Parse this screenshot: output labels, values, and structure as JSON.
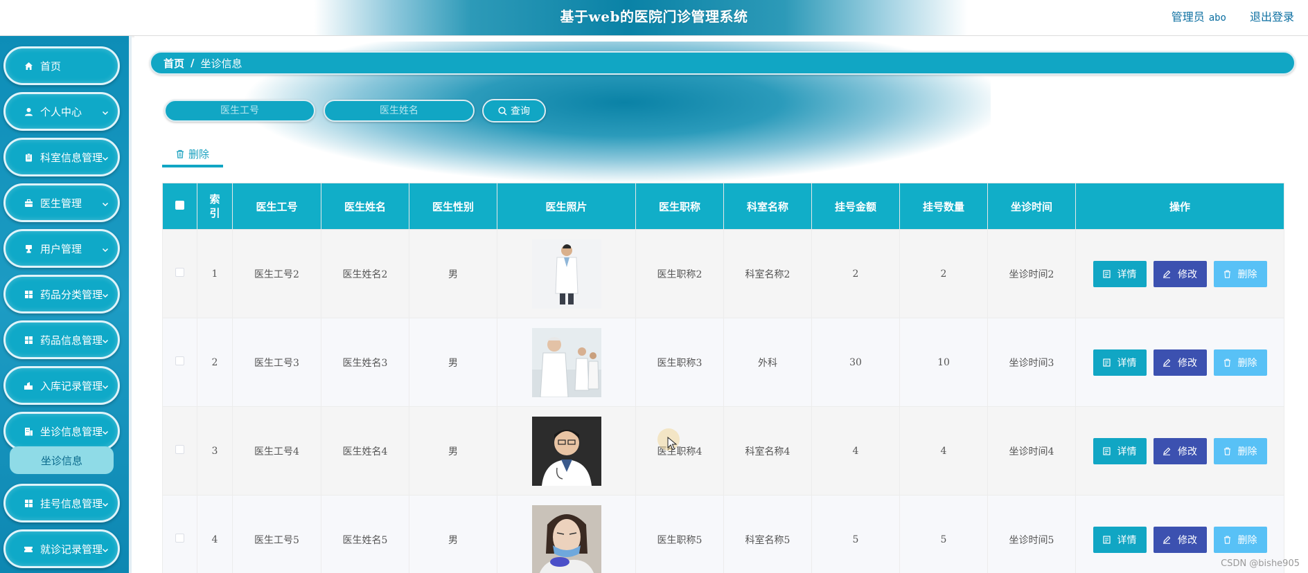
{
  "header": {
    "title": "基于web的医院门诊管理系统",
    "user_role": "管理员",
    "username": "abo",
    "logout": "退出登录"
  },
  "sidebar": {
    "items": [
      {
        "label": "首页",
        "icon": "home-icon",
        "has_children": false
      },
      {
        "label": "个人中心",
        "icon": "user-icon",
        "has_children": true
      },
      {
        "label": "科室信息管理",
        "icon": "clipboard-icon",
        "has_children": true
      },
      {
        "label": "医生管理",
        "icon": "briefcase-icon",
        "has_children": true
      },
      {
        "label": "用户管理",
        "icon": "stamp-icon",
        "has_children": true
      },
      {
        "label": "药品分类管理",
        "icon": "grid-icon",
        "has_children": true
      },
      {
        "label": "药品信息管理",
        "icon": "grid-icon",
        "has_children": true
      },
      {
        "label": "入库记录管理",
        "icon": "inbox-icon",
        "has_children": true
      },
      {
        "label": "坐诊信息管理",
        "icon": "building-icon",
        "has_children": true
      },
      {
        "label": "挂号信息管理",
        "icon": "grid-icon",
        "has_children": true
      },
      {
        "label": "就诊记录管理",
        "icon": "ticket-icon",
        "has_children": true
      }
    ],
    "active_submenu": "坐诊信息"
  },
  "breadcrumb": {
    "home": "首页",
    "separator": "/",
    "current": "坐诊信息"
  },
  "search": {
    "doctor_id_placeholder": "医生工号",
    "doctor_name_placeholder": "医生姓名",
    "query_label": "查询"
  },
  "toolbar": {
    "delete_label": "删除"
  },
  "table": {
    "columns": [
      "索引",
      "医生工号",
      "医生姓名",
      "医生性别",
      "医生照片",
      "医生职称",
      "科室名称",
      "挂号金额",
      "挂号数量",
      "坐诊时间",
      "操作"
    ],
    "rows": [
      {
        "index": "1",
        "doctor_id": "医生工号2",
        "doctor_name": "医生姓名2",
        "gender": "男",
        "photo": "doctor-photo-white-coat",
        "title": "医生职称2",
        "department": "科室名称2",
        "fee": "2",
        "count": "2",
        "time": "坐诊时间2"
      },
      {
        "index": "2",
        "doctor_id": "医生工号3",
        "doctor_name": "医生姓名3",
        "gender": "男",
        "photo": "doctor-photo-group",
        "title": "医生职称3",
        "department": "外科",
        "fee": "30",
        "count": "10",
        "time": "坐诊时间3"
      },
      {
        "index": "3",
        "doctor_id": "医生工号4",
        "doctor_name": "医生姓名4",
        "gender": "男",
        "photo": "doctor-photo-portrait",
        "title": "医生职称4",
        "department": "科室名称4",
        "fee": "4",
        "count": "4",
        "time": "坐诊时间4"
      },
      {
        "index": "4",
        "doctor_id": "医生工号5",
        "doctor_name": "医生姓名5",
        "gender": "男",
        "photo": "doctor-photo-mask",
        "title": "医生职称5",
        "department": "科室名称5",
        "fee": "5",
        "count": "5",
        "time": "坐诊时间5"
      }
    ],
    "actions": {
      "detail": "详情",
      "edit": "修改",
      "delete": "删除"
    }
  },
  "colors": {
    "primary": "#11a6c4",
    "edit": "#3c51b0",
    "delete": "#58c1f6",
    "sidebar": "#0d8db7"
  },
  "watermark": "CSDN @bishe905"
}
